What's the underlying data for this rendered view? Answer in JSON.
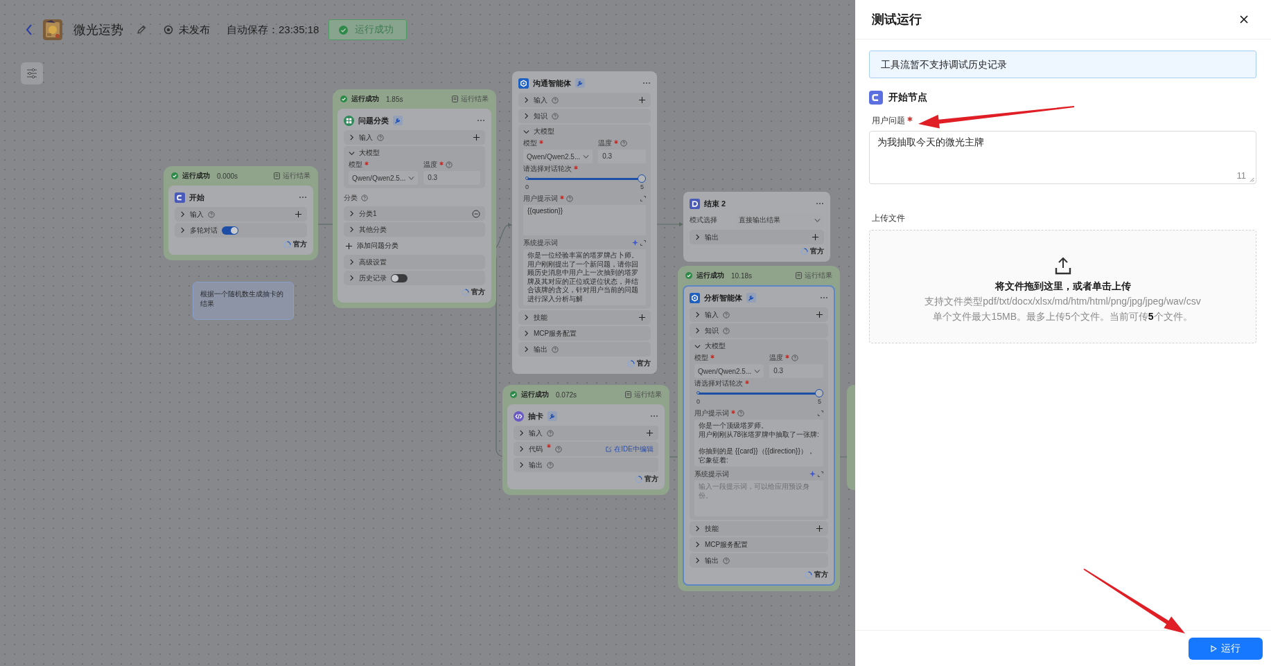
{
  "header": {
    "title": "微光运势",
    "publish_status": "未发布",
    "autosave": "自动保存：23:35:18",
    "run_status": "运行成功"
  },
  "canvas": {
    "nodes": [
      {
        "kind": "start",
        "title": "开始",
        "color": "#4a5ab8",
        "wrench": false,
        "selected": false,
        "run": {
          "status": "运行成功",
          "time": "0.000s",
          "result": "运行结果"
        },
        "badge": "官方",
        "rows": [
          {
            "kind": "section",
            "label": "输入",
            "expanded": false,
            "help": true,
            "add": true
          },
          {
            "kind": "toggle",
            "label": "多轮对话",
            "on": true
          }
        ]
      },
      {
        "kind": "classifier",
        "title": "问题分类",
        "color": "#2f8a5a",
        "wrench": true,
        "selected": false,
        "run": {
          "status": "运行成功",
          "time": "1.85s",
          "result": "运行结果"
        },
        "badge": "官方",
        "rows": [
          {
            "kind": "section",
            "label": "输入",
            "expanded": false,
            "help": true,
            "add": true
          },
          {
            "kind": "model",
            "label": "大模型",
            "expanded": true,
            "model_label": "模型",
            "model": "Qwen/Qwen2.5...",
            "temp_label": "温度",
            "temp": "0.3"
          },
          {
            "kind": "heading",
            "label": "分类",
            "help": true
          },
          {
            "kind": "section",
            "label": "分类1",
            "expanded": false,
            "remove": true
          },
          {
            "kind": "section",
            "label": "其他分类",
            "expanded": false
          },
          {
            "kind": "add_link",
            "label": "添加问题分类"
          },
          {
            "kind": "section",
            "label": "高级设置",
            "expanded": false
          },
          {
            "kind": "toggle",
            "label": "历史记录",
            "on": false
          }
        ]
      },
      {
        "kind": "agent",
        "title": "沟通智能体",
        "color": "#1f5fc0",
        "wrench": true,
        "selected": false,
        "badge": "官方",
        "rows": [
          {
            "kind": "section",
            "label": "输入",
            "expanded": false,
            "help": true,
            "add": true
          },
          {
            "kind": "section",
            "label": "知识",
            "expanded": false,
            "help": true
          },
          {
            "kind": "model",
            "label": "大模型",
            "expanded": true,
            "model_label": "模型",
            "model": "Qwen/Qwen2.5...",
            "temp_label": "温度",
            "temp": "0.3",
            "rounds": {
              "label": "请选择对话轮次",
              "level": 1,
              "min": "0",
              "max": "5"
            },
            "prompts": [
              {
                "label": "用户提示词",
                "required": true,
                "help": true,
                "sparkle": false,
                "paragraphs": [
                  [
                    "{{question}}"
                  ]
                ]
              },
              {
                "label": "系统提示词",
                "required": false,
                "help": false,
                "sparkle": true,
                "paragraphs": [
                  [
                    "你是一位经验丰富的塔罗牌占卜师。用户刚刚提出了一个新问题，请你回顾历史消息中用户上一次抽到的塔罗牌及其对应的正位或逆位状态，并结合该牌的含义，针对用户当前的问题进行深入分析与解"
                  ]
                ]
              }
            ]
          },
          {
            "kind": "section",
            "label": "技能",
            "expanded": false,
            "add": true
          },
          {
            "kind": "section",
            "label": "MCP服务配置",
            "expanded": false
          },
          {
            "kind": "section",
            "label": "输出",
            "expanded": false,
            "help": true
          }
        ]
      },
      {
        "kind": "code",
        "title": "抽卡",
        "color": "#6a58c4",
        "wrench": true,
        "selected": false,
        "run": {
          "status": "运行成功",
          "time": "0.072s",
          "result": "运行结果"
        },
        "badge": "官方",
        "rows": [
          {
            "kind": "section",
            "label": "输入",
            "expanded": false,
            "help": true,
            "add": true
          },
          {
            "kind": "code",
            "label": "代码",
            "expanded": false,
            "required": true,
            "help": true,
            "link": "在IDE中编辑"
          },
          {
            "kind": "section",
            "label": "输出",
            "expanded": false,
            "help": true
          }
        ]
      },
      {
        "kind": "end",
        "title": "结束 2",
        "color": "#4a5ab8",
        "wrench": false,
        "selected": false,
        "badge": "官方",
        "rows": [
          {
            "kind": "select",
            "label": "模式选择",
            "value": "直接输出结果"
          },
          {
            "kind": "section",
            "label": "输出",
            "expanded": false,
            "add": true
          }
        ]
      },
      {
        "kind": "agent",
        "title": "分析智能体",
        "color": "#1f5fc0",
        "wrench": true,
        "selected": true,
        "run": {
          "status": "运行成功",
          "time": "10.18s",
          "result": "运行结果"
        },
        "badge": "官方",
        "rows": [
          {
            "kind": "section",
            "label": "输入",
            "expanded": false,
            "help": true,
            "add": true
          },
          {
            "kind": "section",
            "label": "知识",
            "expanded": false,
            "help": true
          },
          {
            "kind": "model",
            "label": "大模型",
            "expanded": true,
            "model_label": "模型",
            "model": "Qwen/Qwen2.5...",
            "temp_label": "温度",
            "temp": "0.3",
            "rounds": {
              "label": "请选择对话轮次",
              "level": 1,
              "min": "0",
              "max": "5"
            },
            "prompts": [
              {
                "label": "用户提示词",
                "required": true,
                "help": true,
                "sparkle": false,
                "paragraphs": [
                  [
                    "你是一个顶级塔罗师。",
                    "用户刚刚从78张塔罗牌中抽取了一张牌:"
                  ],
                  [
                    "你抽到的是 {{card}}（{{direction}}），它象征着:"
                  ]
                ]
              },
              {
                "label": "系统提示词",
                "required": false,
                "help": false,
                "sparkle": true,
                "placeholder": "输入一段提示词，可以给应用预设身份。"
              }
            ]
          },
          {
            "kind": "section",
            "label": "技能",
            "expanded": false,
            "add": true
          },
          {
            "kind": "section",
            "label": "MCP服务配置",
            "expanded": false
          },
          {
            "kind": "section",
            "label": "输出",
            "expanded": false,
            "help": true
          }
        ]
      }
    ],
    "note": "根据一个随机数生成抽卡的结果"
  },
  "drawer": {
    "title": "测试运行",
    "notice": "工具流暂不支持调试历史记录",
    "section": "开始节点",
    "fields": [
      {
        "label": "用户问题",
        "required": true,
        "value": "为我抽取今天的微光主牌",
        "count": "11"
      }
    ],
    "upload": {
      "label": "上传文件",
      "title": "将文件拖到这里，或者单击上传",
      "types": "支持文件类型pdf/txt/docx/xlsx/md/htm/html/png/jpg/jpeg/wav/csv",
      "limits": "单个文件最大15MB。最多上传5个文件。当前可传**5**个文件。"
    },
    "run_button": "运行"
  }
}
